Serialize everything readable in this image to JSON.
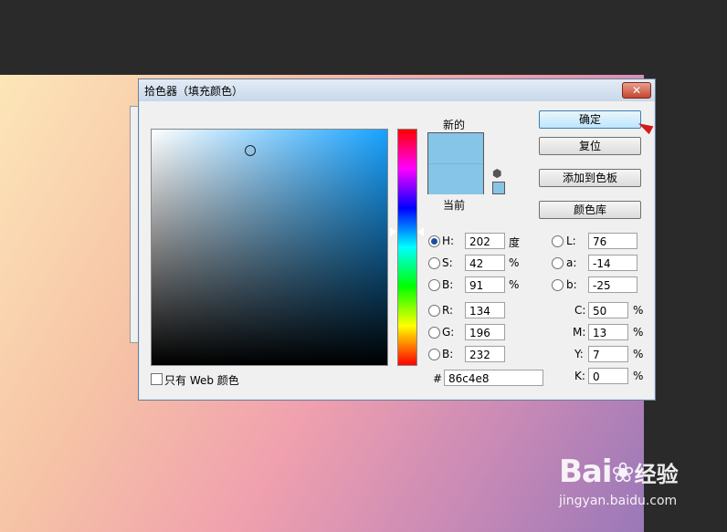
{
  "dialog": {
    "title": "拾色器（填充颜色）",
    "close_glyph": "✕"
  },
  "color_field": {
    "cursor_saturation": 0.42,
    "cursor_brightness": 0.91,
    "hue": 202
  },
  "swatch": {
    "new_label": "新的",
    "current_label": "当前",
    "new_color": "#86c4e8",
    "current_color": "#86c4e8",
    "gamut_icon": "cube-icon"
  },
  "buttons": {
    "ok": "确定",
    "reset": "复位",
    "add_to_swatches": "添加到色板",
    "color_libraries": "颜色库"
  },
  "hsb": {
    "h_label": "H:",
    "h_value": "202",
    "h_unit": "度",
    "s_label": "S:",
    "s_value": "42",
    "s_unit": "%",
    "b_label": "B:",
    "b_value": "91",
    "b_unit": "%"
  },
  "rgb": {
    "r_label": "R:",
    "r_value": "134",
    "g_label": "G:",
    "g_value": "196",
    "b_label": "B:",
    "b_value": "232"
  },
  "lab": {
    "l_label": "L:",
    "l_value": "76",
    "a_label": "a:",
    "a_value": "-14",
    "b_label": "b:",
    "b_value": "-25"
  },
  "cmyk": {
    "c_label": "C:",
    "c_value": "50",
    "m_label": "M:",
    "m_value": "13",
    "y_label": "Y:",
    "y_value": "7",
    "k_label": "K:",
    "k_value": "0",
    "unit": "%"
  },
  "hex": {
    "label": "#",
    "value": "86c4e8"
  },
  "web_only": {
    "label": "只有 Web 颜色",
    "checked": false
  },
  "watermark": {
    "logo": "Bai",
    "logo_cn": "经验",
    "url": "jingyan.baidu.com"
  }
}
